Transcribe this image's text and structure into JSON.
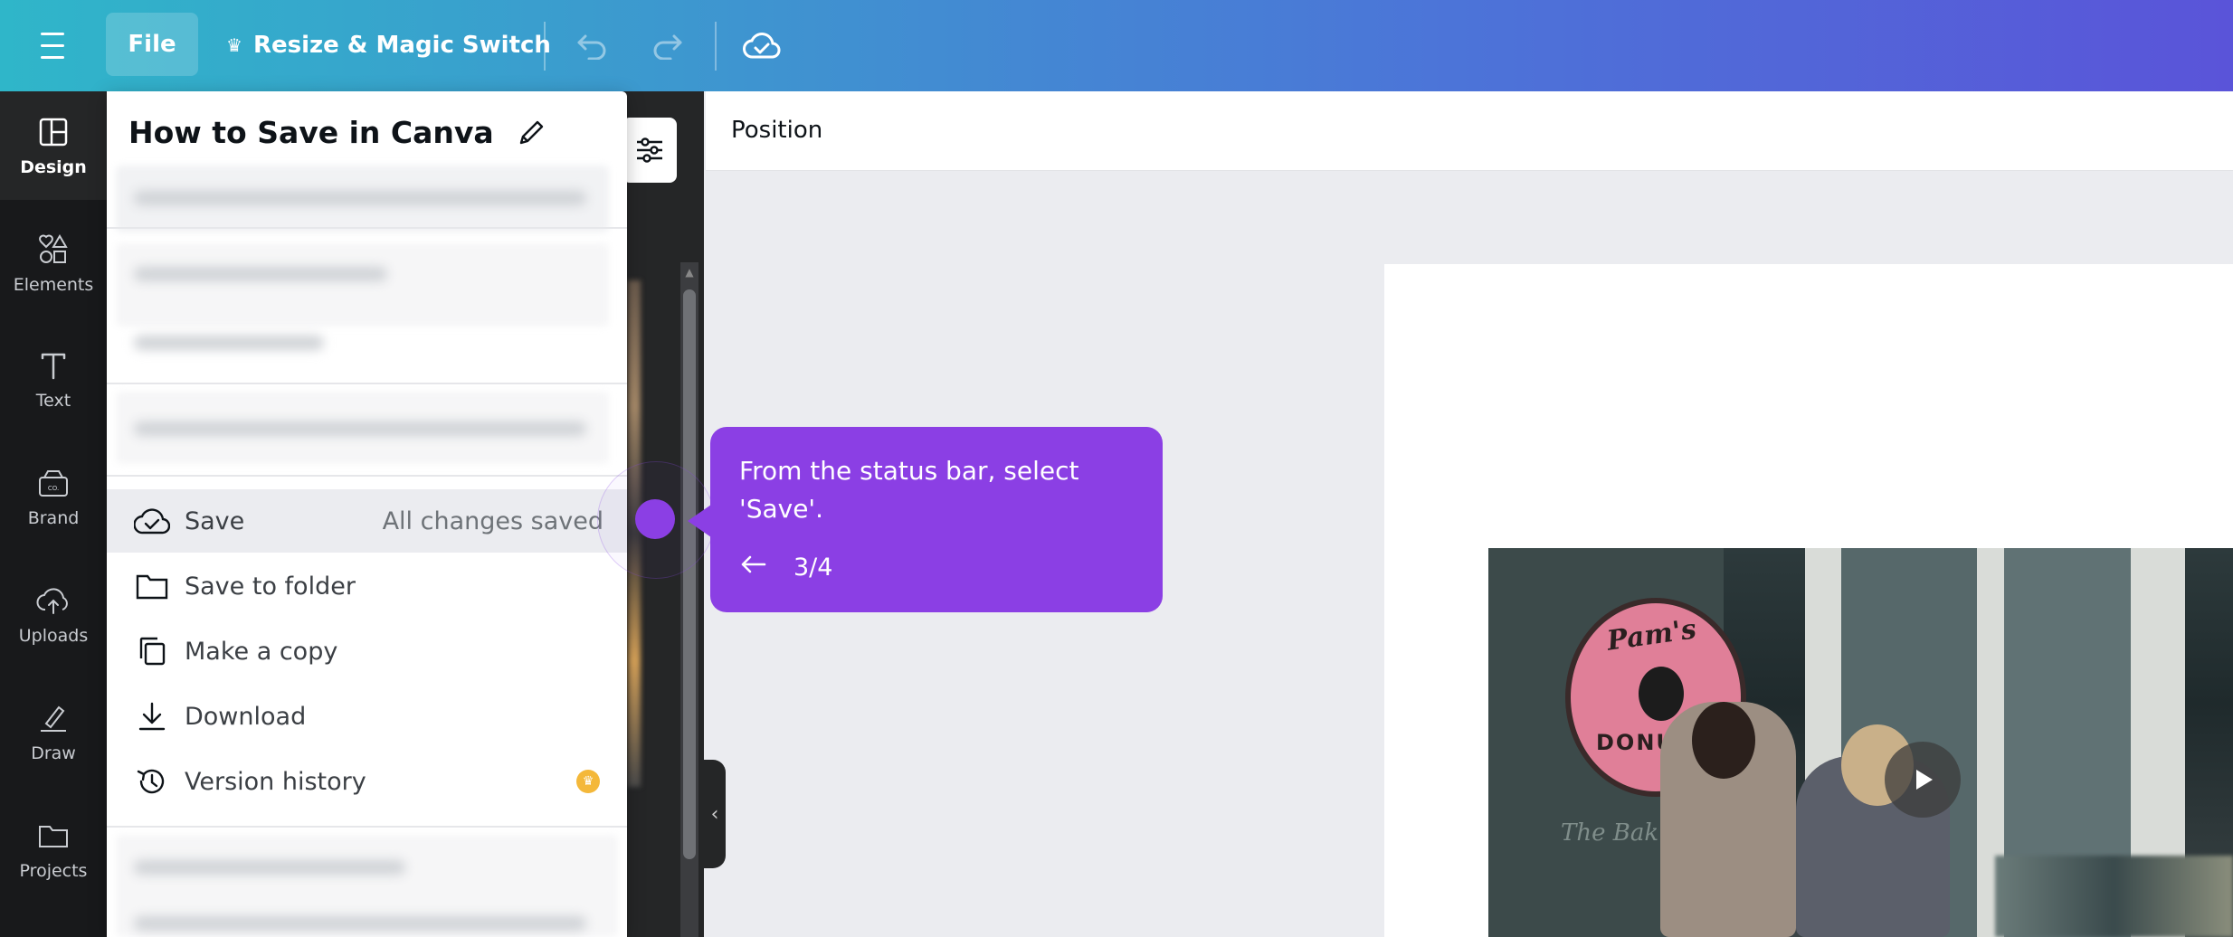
{
  "topbar": {
    "file_label": "File",
    "resize_label": "Resize & Magic Switch"
  },
  "rail": {
    "items": [
      {
        "label": "Design",
        "icon": "layout-icon"
      },
      {
        "label": "Elements",
        "icon": "shapes-icon"
      },
      {
        "label": "Text",
        "icon": "text-icon"
      },
      {
        "label": "Brand",
        "icon": "brand-icon"
      },
      {
        "label": "Uploads",
        "icon": "upload-cloud-icon"
      },
      {
        "label": "Draw",
        "icon": "pen-icon"
      },
      {
        "label": "Projects",
        "icon": "folder-icon"
      }
    ]
  },
  "menu": {
    "title": "How to Save in Canva",
    "items": [
      {
        "label": "Save",
        "status": "All changes saved",
        "icon": "cloud-check-icon"
      },
      {
        "label": "Save to folder",
        "icon": "folder-icon"
      },
      {
        "label": "Make a copy",
        "icon": "copy-icon"
      },
      {
        "label": "Download",
        "icon": "download-icon"
      },
      {
        "label": "Version history",
        "icon": "history-icon",
        "badge": "premium-crown"
      }
    ]
  },
  "editor": {
    "position_label": "Position"
  },
  "tooltip": {
    "text": "From the status bar, select 'Save'.",
    "step": "3/4",
    "color": "#8b3fe4"
  },
  "video": {
    "sign_text_1": "Pam's",
    "sign_text_2": "DONUT",
    "window_text": "The Bak"
  }
}
